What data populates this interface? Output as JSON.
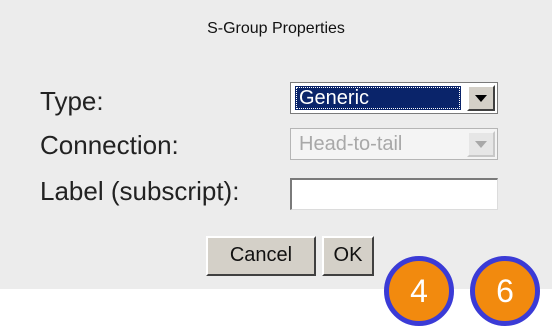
{
  "dialog": {
    "title": "S-Group Properties",
    "type": {
      "label": "Type:",
      "value": "Generic"
    },
    "connection": {
      "label": "Connection:",
      "value": "Head-to-tail",
      "disabled": true
    },
    "label_field": {
      "label": "Label (subscript):",
      "value": ""
    },
    "buttons": {
      "cancel": "Cancel",
      "ok": "OK"
    }
  },
  "badges": [
    {
      "number": "4"
    },
    {
      "number": "6"
    }
  ],
  "colors": {
    "dialog_background": "#ececec",
    "selection_highlight": "#0a246a",
    "badge_fill": "#f28a0e",
    "badge_ring": "#3b3bd6"
  }
}
